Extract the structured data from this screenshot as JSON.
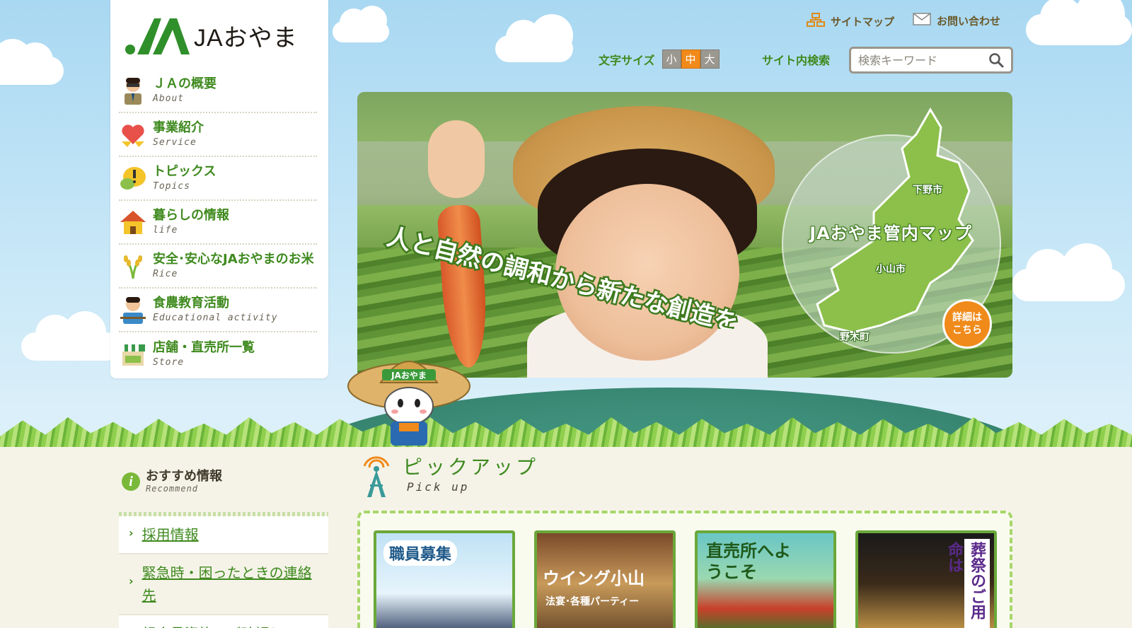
{
  "brand": {
    "name": "JAおやま"
  },
  "header": {
    "sitemap_label": "サイトマップ",
    "contact_label": "お問い合わせ",
    "fontsize_label": "文字サイズ",
    "fontsize_options": [
      "小",
      "中",
      "大"
    ],
    "search_label": "サイト内検索",
    "search_placeholder": "検索キーワード"
  },
  "nav": [
    {
      "ja": "ＪＡの概要",
      "en": "About",
      "icon": "person-icon"
    },
    {
      "ja": "事業紹介",
      "en": "Service",
      "icon": "heart-icon"
    },
    {
      "ja": "トピックス",
      "en": "Topics",
      "icon": "speech-bubble-icon"
    },
    {
      "ja": "暮らしの情報",
      "en": "life",
      "icon": "house-icon"
    },
    {
      "ja": "安全･安心なJAおやまのお米",
      "en": "Rice",
      "icon": "rice-icon"
    },
    {
      "ja": "食農教育活動",
      "en": "Educational activity",
      "icon": "teacher-icon"
    },
    {
      "ja": "店舗・直売所一覧",
      "en": "Store",
      "icon": "store-icon"
    }
  ],
  "hero": {
    "catchphrase": "人と自然の調和から新たな創造を",
    "map_title": "JAおやま管内マップ",
    "map_labels": [
      "下野市",
      "小山市",
      "野木町"
    ],
    "detail_button": [
      "詳細は",
      "こちら"
    ]
  },
  "mascot": {
    "hat_text": "JAおやま"
  },
  "recommend": {
    "title_ja": "おすすめ情報",
    "title_en": "Recommend",
    "items": [
      "採用情報",
      "緊急時・困ったときの連絡先",
      "組合員資格のご確認と"
    ]
  },
  "pickup": {
    "title_ja": "ピックアップ",
    "title_en": "Pick up",
    "cards": [
      "職員募集",
      "ウイング小山",
      "直売所へようこそ",
      "葬祭のご用命は"
    ],
    "card_sub": "法宴･各種パーティー"
  },
  "colors": {
    "accent_green": "#3f8a1f",
    "orange": "#f08a1a",
    "sky": "#a9d8f2"
  }
}
